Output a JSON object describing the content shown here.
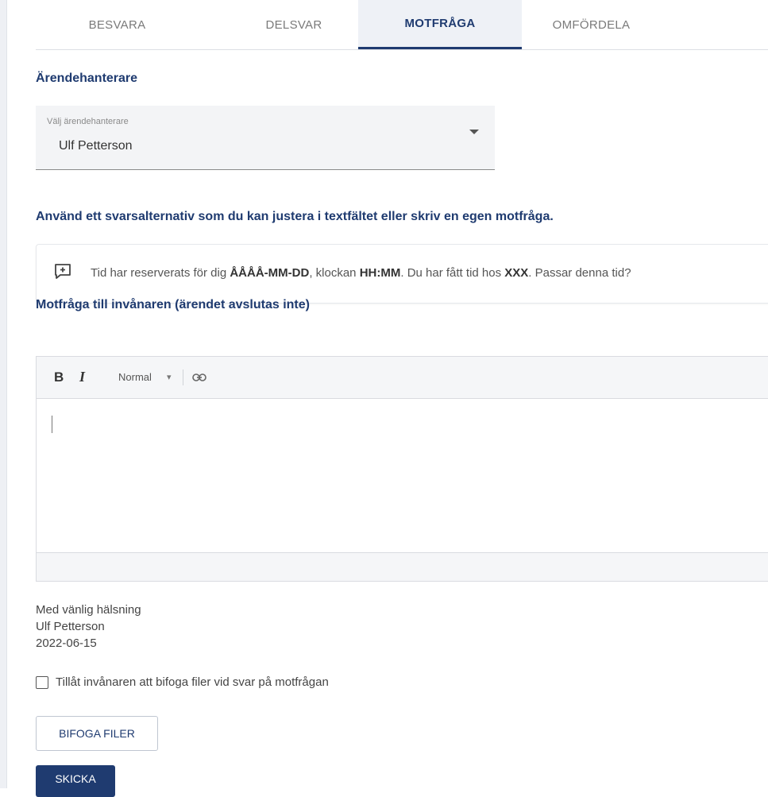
{
  "tabs": [
    {
      "label": "BESVARA"
    },
    {
      "label": "DELSVAR"
    },
    {
      "label": "MOTFRÅGA"
    },
    {
      "label": "OMFÖRDELA"
    }
  ],
  "handler": {
    "heading": "Ärendehanterare",
    "select_label": "Välj ärendehanterare",
    "select_value": "Ulf Petterson"
  },
  "instruction": "Använd ett svarsalternativ som du kan justera i textfältet eller skriv en egen motfråga.",
  "suggestion": {
    "p1": "Tid har reserverats för dig ",
    "b1": "ÅÅÅÅ-MM-DD",
    "p2": ", klockan ",
    "b2": "HH:MM",
    "p3": ". Du har fått tid hos ",
    "b3": "XXX",
    "p4": ". Passar denna tid?"
  },
  "motfraga_heading": "Motfråga till invånaren (ärendet avslutas inte)",
  "editor": {
    "bold": "B",
    "italic": "I",
    "style": "Normal"
  },
  "signature": {
    "greeting": "Med vänlig hälsning",
    "name": "Ulf Petterson",
    "date": "2022-06-15"
  },
  "checkbox_label": "Tillåt invånaren att bifoga filer vid svar på motfrågan",
  "buttons": {
    "attach": "BIFOGA FILER",
    "send": "SKICKA"
  }
}
